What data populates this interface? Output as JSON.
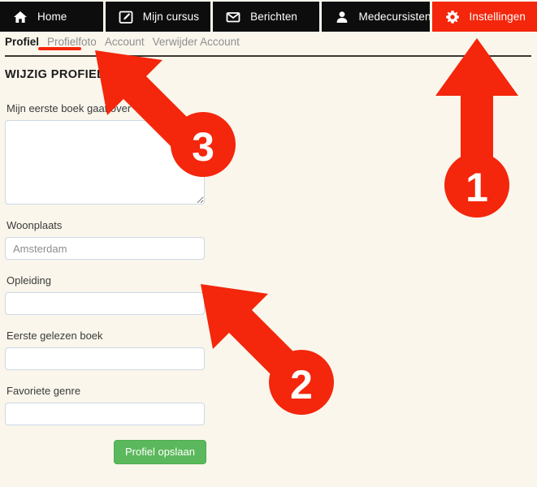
{
  "colors": {
    "page_background": "#faf6ec",
    "nav_background": "#0d0d0d",
    "nav_active": "#f4260b",
    "annotation_red": "#f4260b",
    "save_green": "#5cb85c",
    "divider": "#3b3730"
  },
  "topnav": {
    "items": [
      {
        "label": "Home",
        "icon": "home-icon",
        "active": false
      },
      {
        "label": "Mijn cursus",
        "icon": "pencil-square-icon",
        "active": false
      },
      {
        "label": "Berichten",
        "icon": "envelope-icon",
        "active": false
      },
      {
        "label": "Medecursisten",
        "icon": "user-icon",
        "active": false
      },
      {
        "label": "Instellingen",
        "icon": "gear-icon",
        "active": true
      }
    ]
  },
  "subtabs": {
    "items": [
      {
        "label": "Profiel",
        "active": true
      },
      {
        "label": "Profielfoto",
        "active": false
      },
      {
        "label": "Account",
        "active": false
      },
      {
        "label": "Verwijder Account",
        "active": false
      }
    ]
  },
  "form": {
    "title": "WIJZIG PROFIEL",
    "fields": [
      {
        "label": "Mijn eerste boek gaat over",
        "type": "textarea",
        "value": "",
        "placeholder": ""
      },
      {
        "label": "Woonplaats",
        "type": "text",
        "value": "",
        "placeholder": "Amsterdam"
      },
      {
        "label": "Opleiding",
        "type": "text",
        "value": "",
        "placeholder": ""
      },
      {
        "label": "Eerste gelezen boek",
        "type": "text",
        "value": "",
        "placeholder": ""
      },
      {
        "label": "Favoriete genre",
        "type": "text",
        "value": "",
        "placeholder": ""
      }
    ],
    "save_label": "Profiel opslaan"
  },
  "annotations": [
    {
      "number": "1",
      "target": "Instellingen",
      "direction": "up"
    },
    {
      "number": "2",
      "target": "Opleiding",
      "direction": "up-left"
    },
    {
      "number": "3",
      "target": "Profielfoto",
      "direction": "up-left"
    }
  ]
}
